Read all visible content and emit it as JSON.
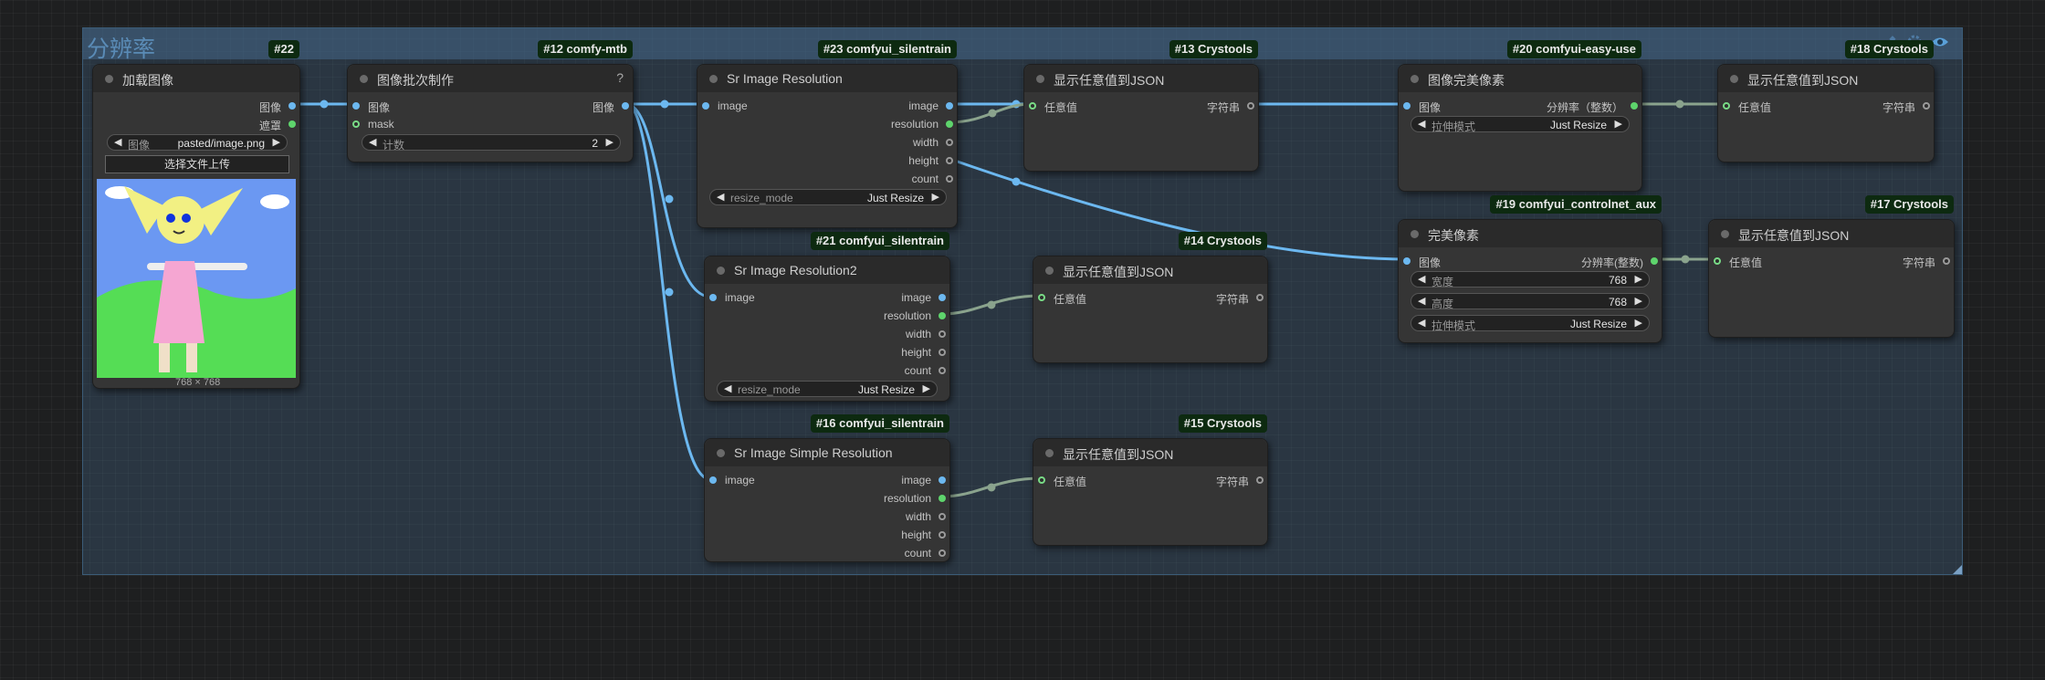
{
  "group": {
    "title": "分辨率",
    "icons": [
      "brush-icon",
      "settings-icon",
      "eye-icon"
    ]
  },
  "nodes": {
    "n22": {
      "badge": "#22",
      "title": "加载图像",
      "outputs": [
        "图像",
        "遮罩"
      ],
      "widget_label": "图像",
      "widget_value": "pasted/image.png",
      "button": "选择文件上传",
      "caption": "768 × 768"
    },
    "n12": {
      "badge": "#12 comfy-mtb",
      "title": "图像批次制作",
      "help": "?",
      "inputs": [
        "图像",
        "mask"
      ],
      "outputs": [
        "图像"
      ],
      "widget_label": "计数",
      "widget_value": "2"
    },
    "n23": {
      "badge": "#23 comfyui_silentrain",
      "title": "Sr Image Resolution",
      "inputs": [
        "image"
      ],
      "outputs": [
        "image",
        "resolution",
        "width",
        "height",
        "count"
      ],
      "widget_label": "resize_mode",
      "widget_value": "Just Resize"
    },
    "n21": {
      "badge": "#21 comfyui_silentrain",
      "title": "Sr Image Resolution2",
      "inputs": [
        "image"
      ],
      "outputs": [
        "image",
        "resolution",
        "width",
        "height",
        "count"
      ],
      "widget_label": "resize_mode",
      "widget_value": "Just Resize"
    },
    "n16": {
      "badge": "#16 comfyui_silentrain",
      "title": "Sr Image Simple Resolution",
      "inputs": [
        "image"
      ],
      "outputs": [
        "image",
        "resolution",
        "width",
        "height",
        "count"
      ]
    },
    "n13": {
      "badge": "#13 Crystools",
      "title": "显示任意值到JSON",
      "inputs": [
        "任意值"
      ],
      "outputs": [
        "字符串"
      ]
    },
    "n14": {
      "badge": "#14 Crystools",
      "title": "显示任意值到JSON",
      "inputs": [
        "任意值"
      ],
      "outputs": [
        "字符串"
      ]
    },
    "n15": {
      "badge": "#15 Crystools",
      "title": "显示任意值到JSON",
      "inputs": [
        "任意值"
      ],
      "outputs": [
        "字符串"
      ]
    },
    "n20": {
      "badge": "#20 comfyui-easy-use",
      "title": "图像完美像素",
      "inputs": [
        "图像"
      ],
      "outputs": [
        "分辨率（整数）"
      ],
      "widget_label": "拉伸模式",
      "widget_value": "Just Resize"
    },
    "n18": {
      "badge": "#18 Crystools",
      "title": "显示任意值到JSON",
      "inputs": [
        "任意值"
      ],
      "outputs": [
        "字符串"
      ]
    },
    "n19": {
      "badge": "#19 comfyui_controlnet_aux",
      "title": "完美像素",
      "inputs": [
        "图像"
      ],
      "outputs": [
        "分辨率(整数)"
      ],
      "widgets": [
        {
          "label": "宽度",
          "value": "768"
        },
        {
          "label": "高度",
          "value": "768"
        },
        {
          "label": "拉伸模式",
          "value": "Just Resize"
        }
      ]
    },
    "n17": {
      "badge": "#17 Crystools",
      "title": "显示任意值到JSON",
      "inputs": [
        "任意值"
      ],
      "outputs": [
        "字符串"
      ]
    }
  },
  "colors": {
    "image_link": "#6cb8f0",
    "resolution_link": "#8aa38d",
    "badge_bg": "#0d2a10",
    "group_title": "#5a8bb6"
  }
}
